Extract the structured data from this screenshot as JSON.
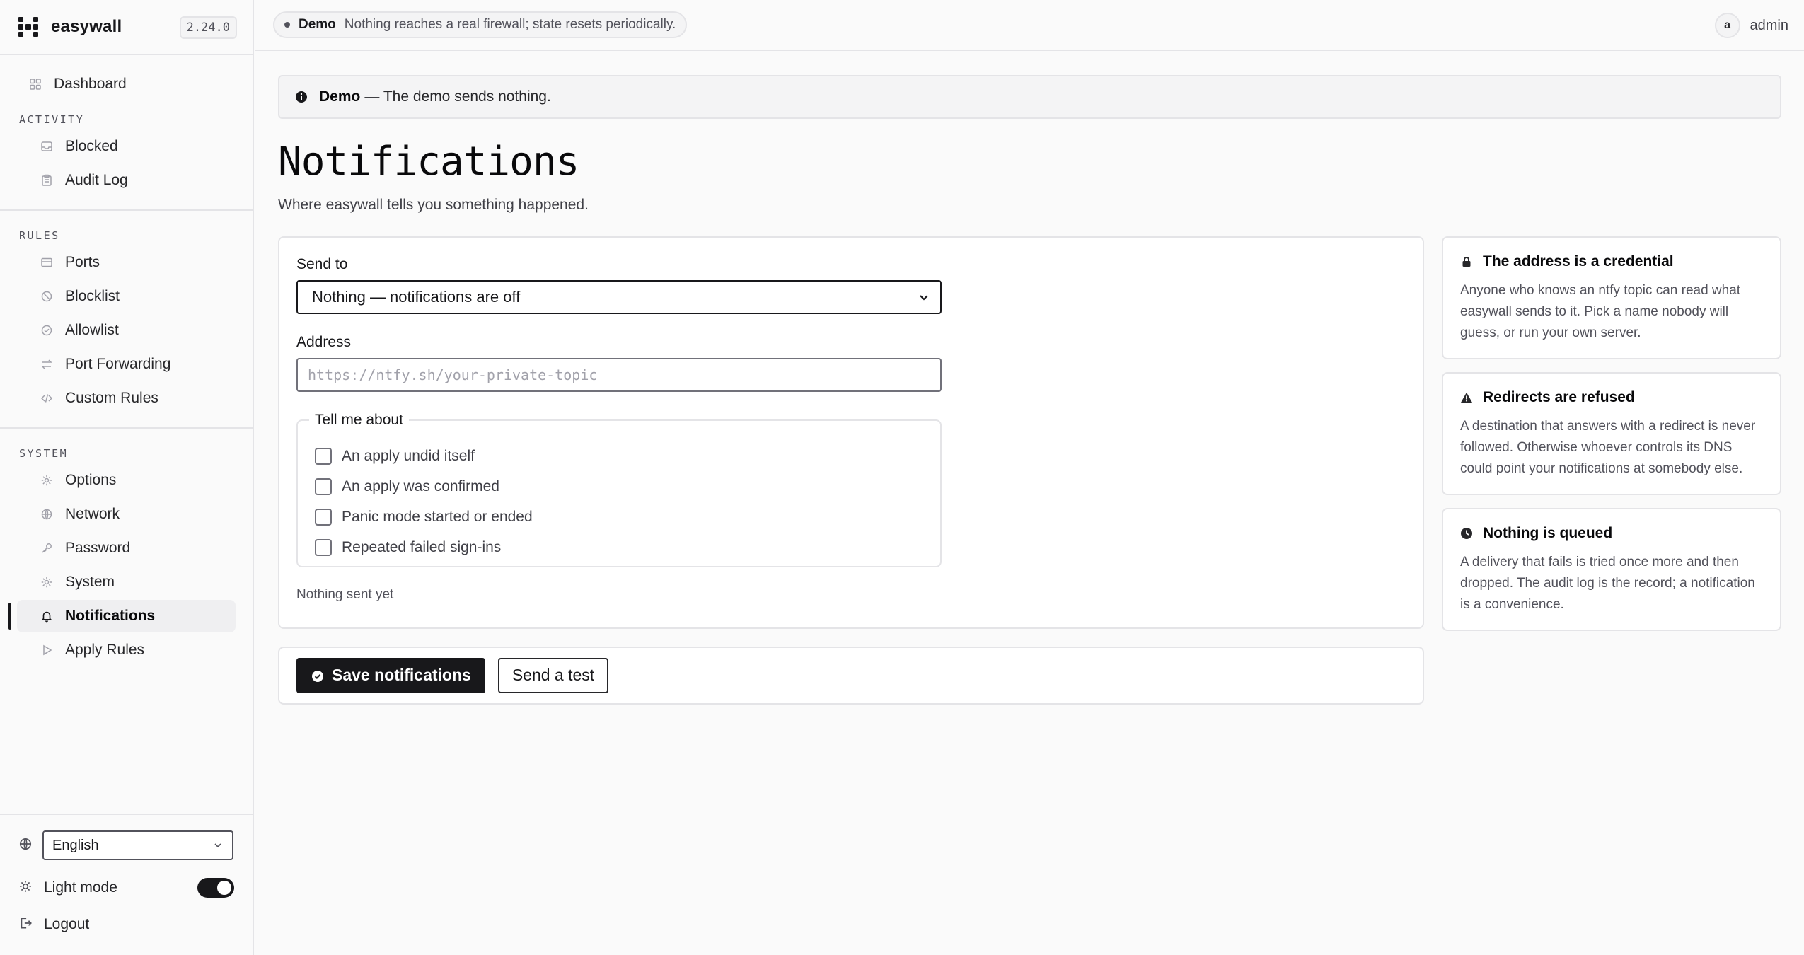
{
  "app": {
    "name": "easywall",
    "version": "2.24.0"
  },
  "sidebar": {
    "dashboard": {
      "label": "Dashboard",
      "icon": "dashboard-icon"
    },
    "sections": [
      {
        "label": "ACTIVITY",
        "items": [
          {
            "label": "Blocked",
            "icon": "inbox-icon"
          },
          {
            "label": "Audit Log",
            "icon": "clipboard-icon"
          }
        ]
      },
      {
        "label": "RULES",
        "items": [
          {
            "label": "Ports",
            "icon": "drawer-icon"
          },
          {
            "label": "Blocklist",
            "icon": "ban-icon"
          },
          {
            "label": "Allowlist",
            "icon": "check-circle-icon"
          },
          {
            "label": "Port Forwarding",
            "icon": "arrows-swap-icon"
          },
          {
            "label": "Custom Rules",
            "icon": "code-icon"
          }
        ]
      },
      {
        "label": "SYSTEM",
        "items": [
          {
            "label": "Options",
            "icon": "gear-icon"
          },
          {
            "label": "Network",
            "icon": "globe-icon"
          },
          {
            "label": "Password",
            "icon": "key-icon"
          },
          {
            "label": "System",
            "icon": "gear-icon"
          },
          {
            "label": "Notifications",
            "icon": "bell-icon",
            "active": true
          },
          {
            "label": "Apply Rules",
            "icon": "play-icon"
          }
        ]
      }
    ],
    "language": "English",
    "light_mode_label": "Light mode",
    "light_mode_on": true,
    "logout_label": "Logout"
  },
  "topbar": {
    "demo_label": "Demo",
    "demo_text": "Nothing reaches a real firewall; state resets periodically.",
    "user_initial": "a",
    "user_name": "admin"
  },
  "banner": {
    "title": "Demo",
    "text": "— The demo sends nothing."
  },
  "page": {
    "title": "Notifications",
    "subtitle": "Where easywall tells you something happened."
  },
  "form": {
    "send_to_label": "Send to",
    "send_to_value": "Nothing — notifications are off",
    "address_label": "Address",
    "address_placeholder": "https://ntfy.sh/your-private-topic",
    "address_value": "",
    "events_legend": "Tell me about",
    "events": [
      {
        "label": "An apply undid itself",
        "checked": false
      },
      {
        "label": "An apply was confirmed",
        "checked": false
      },
      {
        "label": "Panic mode started or ended",
        "checked": false
      },
      {
        "label": "Repeated failed sign-ins",
        "checked": false
      }
    ],
    "status_text": "Nothing sent yet"
  },
  "actions": {
    "save_label": "Save notifications",
    "test_label": "Send a test"
  },
  "info_cards": [
    {
      "icon": "lock-icon",
      "title": "The address is a credential",
      "body": "Anyone who knows an ntfy topic can read what easywall sends to it. Pick a name nobody will guess, or run your own server."
    },
    {
      "icon": "warning-icon",
      "title": "Redirects are refused",
      "body": "A destination that answers with a redirect is never followed. Otherwise whoever controls its DNS could point your notifications at somebody else."
    },
    {
      "icon": "clock-icon",
      "title": "Nothing is queued",
      "body": "A delivery that fails is tried once more and then dropped. The audit log is the record; a notification is a convenience."
    }
  ]
}
